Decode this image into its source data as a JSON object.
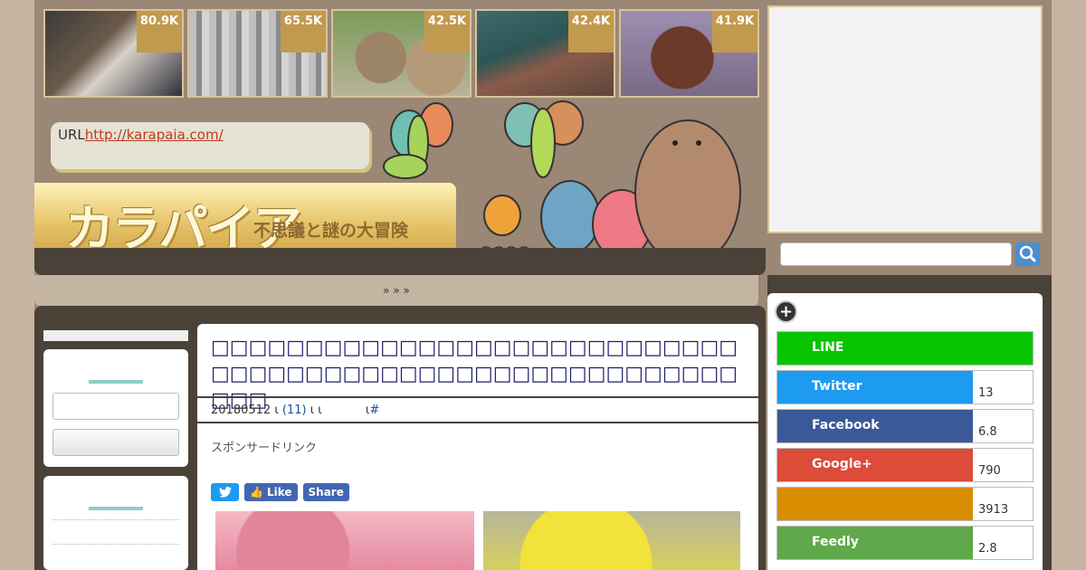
{
  "thumbs": [
    {
      "count": "80.9K"
    },
    {
      "count": "65.5K"
    },
    {
      "count": "42.5K"
    },
    {
      "count": "42.4K"
    },
    {
      "count": "41.9K"
    }
  ],
  "site": {
    "url_label": "URL",
    "url": "http://karapaia.com/",
    "logo": "カラパイア",
    "tagline": "不思議と謎の大冒険"
  },
  "breadcrumb": "» » »",
  "article": {
    "title": "□□□□□□□□□□□□□□□□□□□□□□□□□□□□□□□□□□□□□□□□□□□□□□□□□□□□□□□□□□□",
    "date": "20180512",
    "comments": "(11)",
    "hash": "#",
    "sponsor": "スポンサードリンク",
    "share_like": "Like",
    "share_share": "Share"
  },
  "social": [
    {
      "label": "LINE",
      "count": "",
      "color": "#06c400"
    },
    {
      "label": "Twitter",
      "count": "13",
      "color": "#1d9bf0"
    },
    {
      "label": "Facebook",
      "count": "6.8",
      "color": "#3b5998"
    },
    {
      "label": "Google+",
      "count": "790",
      "color": "#dd4b39"
    },
    {
      "label": "",
      "count": "3913",
      "color": "#d98c00"
    },
    {
      "label": "Feedly",
      "count": "2.8",
      "color": "#6cc04a"
    }
  ]
}
